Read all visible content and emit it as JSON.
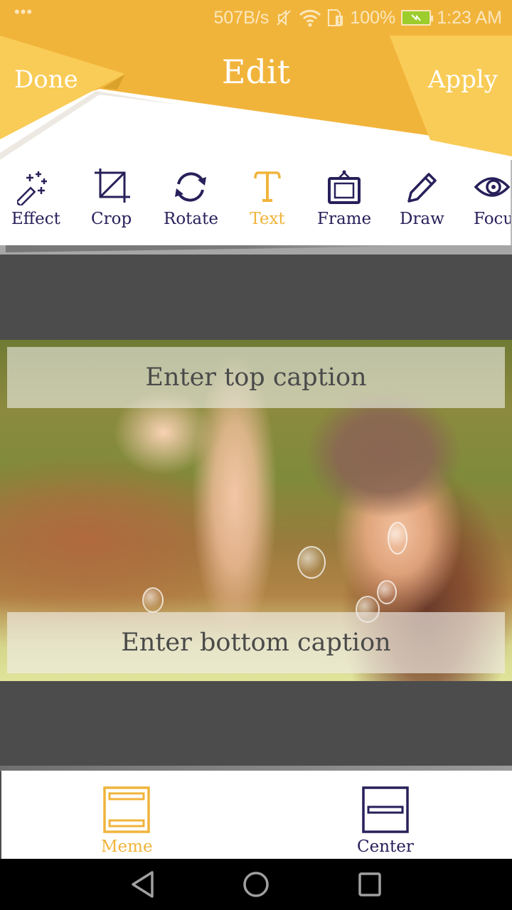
{
  "status_bar": {
    "menu_dots": "•••",
    "net_speed": "507B/s",
    "icons": [
      "mute-icon",
      "wifi-icon",
      "sim-alert-icon"
    ],
    "battery": "100%",
    "battery_icon": "battery-charging-icon",
    "time": "1:23 AM"
  },
  "header": {
    "done_label": "Done",
    "title": "Edit",
    "apply_label": "Apply"
  },
  "toolbar": {
    "items": [
      {
        "label": "Effect",
        "icon": "magic-wand-icon",
        "active": false
      },
      {
        "label": "Crop",
        "icon": "crop-icon",
        "active": false
      },
      {
        "label": "Rotate",
        "icon": "rotate-icon",
        "active": false
      },
      {
        "label": "Text",
        "icon": "text-icon",
        "active": true
      },
      {
        "label": "Frame",
        "icon": "frame-icon",
        "active": false
      },
      {
        "label": "Draw",
        "icon": "pencil-icon",
        "active": false
      },
      {
        "label": "Focu",
        "icon": "eye-icon",
        "active": false
      }
    ]
  },
  "canvas": {
    "top_caption": {
      "value": "",
      "placeholder": "Enter top caption"
    },
    "bottom_caption": {
      "value": "",
      "placeholder": "Enter bottom caption"
    }
  },
  "modes": {
    "items": [
      {
        "label": "Meme",
        "icon": "meme-layout-icon",
        "active": true
      },
      {
        "label": "Center",
        "icon": "center-layout-icon",
        "active": false
      }
    ]
  },
  "nav_bar": {
    "back": "back-icon",
    "home": "home-icon",
    "recents": "recents-icon"
  },
  "colors": {
    "accent": "#f0b43c",
    "accent_light": "#f9cc57",
    "ink": "#27205a",
    "canvas_bg": "#4c4c4c"
  }
}
